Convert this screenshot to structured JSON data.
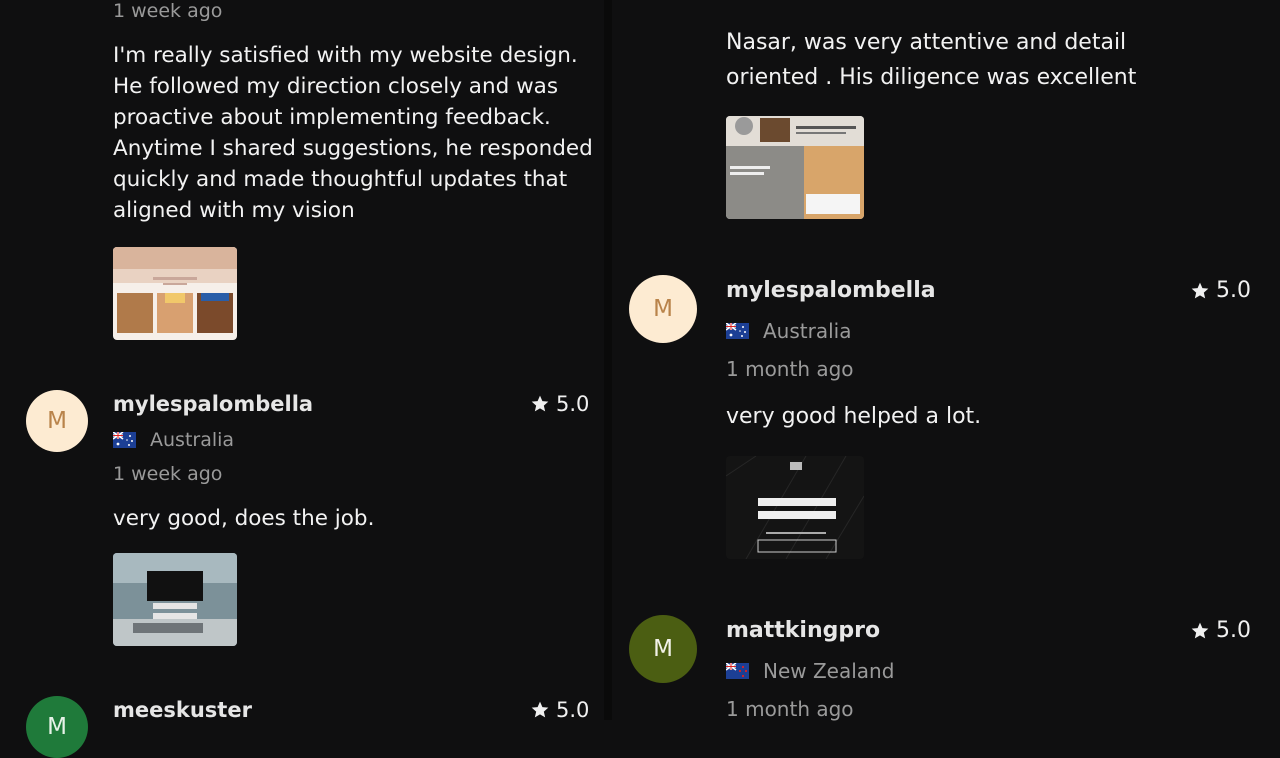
{
  "left": {
    "top_review": {
      "time": "1 week ago",
      "text_lines": [
        "I'm really satisfied with my website design.",
        "He followed my direction closely and was",
        "proactive about implementing feedback.",
        "Anytime I shared suggestions, he responded",
        "quickly and made thoughtful updates that",
        "aligned with my vision"
      ]
    },
    "review2": {
      "avatar_letter": "M",
      "username": "mylespalombella",
      "country": "Australia",
      "rating": "5.0",
      "time": "1 week ago",
      "text": "very good, does the job."
    },
    "review3": {
      "avatar_letter": "M",
      "username": "meeskuster",
      "rating": "5.0"
    }
  },
  "right": {
    "top_review": {
      "text_lines": [
        "Nasar, was very attentive and detail",
        "oriented . His diligence was excellent"
      ]
    },
    "review2": {
      "avatar_letter": "M",
      "username": "mylespalombella",
      "country": "Australia",
      "rating": "5.0",
      "time": "1 month ago",
      "text": "very good helped a lot."
    },
    "review3": {
      "avatar_letter": "M",
      "username": "mattkingpro",
      "country": "New Zealand",
      "rating": "5.0",
      "time": "1 month ago"
    }
  },
  "colors": {
    "background": "#0f0f10",
    "avatar_peach_bg": "#fdebd2",
    "avatar_peach_fg": "#b9834a",
    "avatar_olive_bg": "#4b5e12",
    "avatar_green_bg": "#1f7a3a"
  },
  "icons": [
    "star-icon",
    "australia-flag-icon",
    "new-zealand-flag-icon"
  ]
}
